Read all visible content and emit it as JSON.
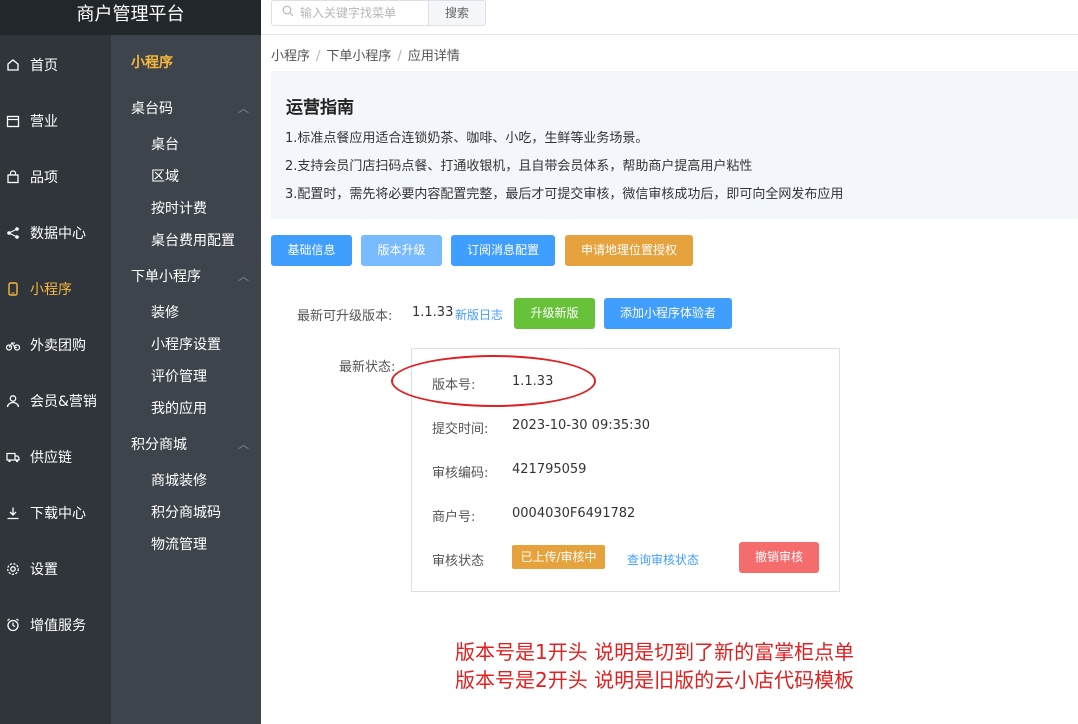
{
  "app": {
    "title": "商户管理平台"
  },
  "search": {
    "placeholder": "输入关键字找菜单",
    "button": "搜索"
  },
  "primary_nav": [
    {
      "label": "首页",
      "icon": "home-icon"
    },
    {
      "label": "营业",
      "icon": "calendar-icon"
    },
    {
      "label": "品项",
      "icon": "bag-icon"
    },
    {
      "label": "数据中心",
      "icon": "share-icon"
    },
    {
      "label": "小程序",
      "icon": "phone-icon",
      "active": true
    },
    {
      "label": "外卖团购",
      "icon": "bike-icon"
    },
    {
      "label": "会员&营销",
      "icon": "user-icon"
    },
    {
      "label": "供应链",
      "icon": "truck-icon"
    },
    {
      "label": "下载中心",
      "icon": "download-icon"
    },
    {
      "label": "设置",
      "icon": "gear-icon"
    },
    {
      "label": "增值服务",
      "icon": "alarm-icon"
    }
  ],
  "secondary_nav": {
    "title": "小程序",
    "groups": [
      {
        "label": "桌台码",
        "items": [
          "桌台",
          "区域",
          "按时计费",
          "桌台费用配置"
        ]
      },
      {
        "label": "下单小程序",
        "items": [
          "装修",
          "小程序设置",
          "评价管理",
          "我的应用"
        ]
      },
      {
        "label": "积分商城",
        "items": [
          "商城装修",
          "积分商城码",
          "物流管理"
        ]
      }
    ]
  },
  "breadcrumb": [
    "小程序",
    "下单小程序",
    "应用详情"
  ],
  "guide": {
    "title": "运营指南",
    "lines": [
      "1.标准点餐应用适合连锁奶茶、咖啡、小吃，生鲜等业务场景。",
      "2.支持会员门店扫码点餐、打通收银机，且自带会员体系，帮助商户提高用户粘性",
      "3.配置时，需先将必要内容配置完整，最后才可提交审核，微信审核成功后，即可向全网发布应用"
    ]
  },
  "tabs": [
    "基础信息",
    "版本升级",
    "订阅消息配置",
    "申请地理位置授权"
  ],
  "upgrade": {
    "label": "最新可升级版本:",
    "version": "1.1.33",
    "changelog_link": "新版日志",
    "upgrade_button": "升级新版",
    "add_tester_button": "添加小程序体验者"
  },
  "status": {
    "label": "最新状态:",
    "version_label": "版本号:",
    "version": "1.1.33",
    "submit_time_label": "提交时间:",
    "submit_time": "2023-10-30 09:35:30",
    "audit_code_label": "审核编码:",
    "audit_code": "421795059",
    "merchant_no_label": "商户号:",
    "merchant_no": "0004030F6491782",
    "audit_status_label": "审核状态",
    "audit_status": "已上传/审核中",
    "query_link": "查询审核状态",
    "revoke_button": "撤销审核"
  },
  "notes": [
    "版本号是1开头  说明是切到了新的富掌柜点单",
    "版本号是2开头  说明是旧版的云小店代码模板"
  ],
  "colors": {
    "accent": "#f6b73c",
    "primary": "#409eff",
    "annotation": "#e02020"
  }
}
